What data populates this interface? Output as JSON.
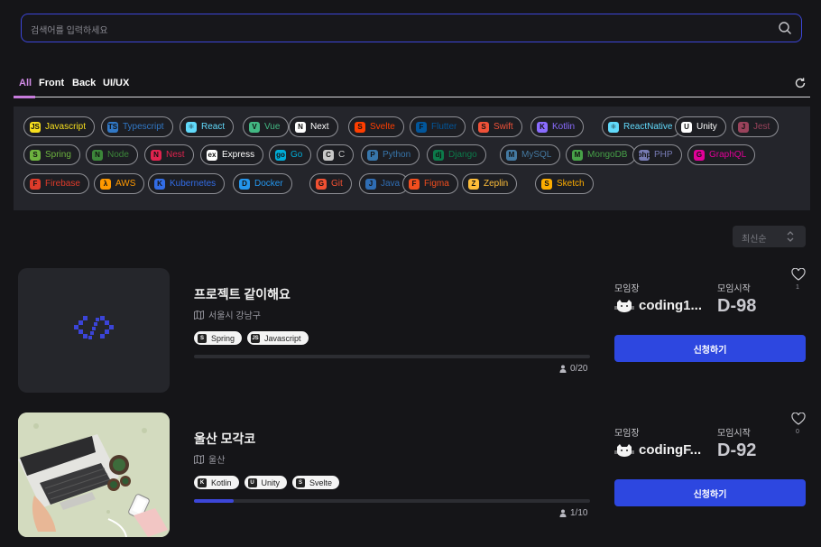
{
  "search": {
    "placeholder": "검색어를 입력하세요"
  },
  "tabs": [
    {
      "label": "All",
      "active": true
    },
    {
      "label": "Front",
      "active": false
    },
    {
      "label": "Back",
      "active": false
    },
    {
      "label": "UI/UX",
      "active": false
    }
  ],
  "stacks": [
    {
      "label": "Javascript",
      "color": "#f7df1e",
      "icon": "javascript-icon",
      "glyph": "JS"
    },
    {
      "label": "Typescript",
      "color": "#3178c6",
      "icon": "typescript-icon",
      "glyph": "TS"
    },
    {
      "label": "React",
      "color": "#61dafb",
      "icon": "react-icon",
      "glyph": "⚛"
    },
    {
      "label": "Vue",
      "color": "#42b883",
      "icon": "vue-icon",
      "glyph": "V"
    },
    {
      "label": "Next",
      "color": "#ffffff",
      "icon": "next-icon",
      "glyph": "N"
    },
    {
      "label": "Svelte",
      "color": "#ff3e00",
      "icon": "svelte-icon",
      "glyph": "S"
    },
    {
      "label": "Flutter",
      "color": "#02569b",
      "icon": "flutter-icon",
      "glyph": "F"
    },
    {
      "label": "Swift",
      "color": "#f05138",
      "icon": "swift-icon",
      "glyph": "S"
    },
    {
      "label": "Kotlin",
      "color": "#8a6cff",
      "icon": "kotlin-icon",
      "glyph": "K"
    },
    {
      "label": "ReactNative",
      "color": "#61dafb",
      "icon": "react-native-icon",
      "glyph": "⚛"
    },
    {
      "label": "Unity",
      "color": "#ffffff",
      "icon": "unity-icon",
      "glyph": "U"
    },
    {
      "label": "Jest",
      "color": "#99425b",
      "icon": "jest-icon",
      "glyph": "J"
    },
    {
      "label": "Spring",
      "color": "#6db33f",
      "icon": "spring-icon",
      "glyph": "S"
    },
    {
      "label": "Node",
      "color": "#3c873a",
      "icon": "node-icon",
      "glyph": "N"
    },
    {
      "label": "Nest",
      "color": "#e0234e",
      "icon": "nest-icon",
      "glyph": "N"
    },
    {
      "label": "Express",
      "color": "#ffffff",
      "icon": "express-icon",
      "glyph": "ex"
    },
    {
      "label": "Go",
      "color": "#00add8",
      "icon": "go-icon",
      "glyph": "go"
    },
    {
      "label": "C",
      "color": "#c8c8c8",
      "icon": "c-icon",
      "glyph": "C"
    },
    {
      "label": "Python",
      "color": "#3776ab",
      "icon": "python-icon",
      "glyph": "P"
    },
    {
      "label": "Django",
      "color": "#0c7a4a",
      "icon": "django-icon",
      "glyph": "dj"
    },
    {
      "label": "MySQL",
      "color": "#4479a1",
      "icon": "mysql-icon",
      "glyph": "M"
    },
    {
      "label": "MongoDB",
      "color": "#47a248",
      "icon": "mongodb-icon",
      "glyph": "M"
    },
    {
      "label": "PHP",
      "color": "#777bb4",
      "icon": "php-icon",
      "glyph": "php"
    },
    {
      "label": "GraphQL",
      "color": "#e10098",
      "icon": "graphql-icon",
      "glyph": "G"
    },
    {
      "label": "Firebase",
      "color": "#dd3b2a",
      "icon": "firebase-icon",
      "glyph": "F"
    },
    {
      "label": "AWS",
      "color": "#ff9900",
      "icon": "aws-icon",
      "glyph": "λ"
    },
    {
      "label": "Kubernetes",
      "color": "#326ce5",
      "icon": "kubernetes-icon",
      "glyph": "K"
    },
    {
      "label": "Docker",
      "color": "#2496ed",
      "icon": "docker-icon",
      "glyph": "D"
    },
    {
      "label": "Git",
      "color": "#f05032",
      "icon": "git-icon",
      "glyph": "G"
    },
    {
      "label": "Java",
      "color": "#2f6db3",
      "icon": "java-icon",
      "glyph": "J"
    },
    {
      "label": "Figma",
      "color": "#f24e1e",
      "icon": "figma-icon",
      "glyph": "F"
    },
    {
      "label": "Zeplin",
      "color": "#fdbd39",
      "icon": "zeplin-icon",
      "glyph": "Z"
    },
    {
      "label": "Sketch",
      "color": "#fdad00",
      "icon": "sketch-icon",
      "glyph": "S"
    }
  ],
  "sort": {
    "label": "최신순"
  },
  "labels": {
    "leader": "모임장",
    "start": "모임시작",
    "apply": "신청하기"
  },
  "posts": [
    {
      "title": "프로젝트 같이해요",
      "location": "서울시 강남구",
      "tags": [
        {
          "label": "Spring",
          "glyph": "S",
          "icon": "spring-icon"
        },
        {
          "label": "Javascript",
          "glyph": "JS",
          "icon": "javascript-icon"
        }
      ],
      "progress": 0.0,
      "members": "0/20",
      "leader": "coding1...",
      "dday": "D-98",
      "likes": "1",
      "thumb": "code-icon"
    },
    {
      "title": "울산 모각코",
      "location": "울산",
      "tags": [
        {
          "label": "Kotlin",
          "glyph": "K",
          "icon": "kotlin-icon"
        },
        {
          "label": "Unity",
          "glyph": "U",
          "icon": "unity-icon"
        },
        {
          "label": "Svelte",
          "glyph": "S",
          "icon": "svelte-icon"
        }
      ],
      "progress": 0.1,
      "members": "1/10",
      "leader": "codingF...",
      "dday": "D-92",
      "likes": "0",
      "thumb": "laptop-desk-photo"
    }
  ]
}
